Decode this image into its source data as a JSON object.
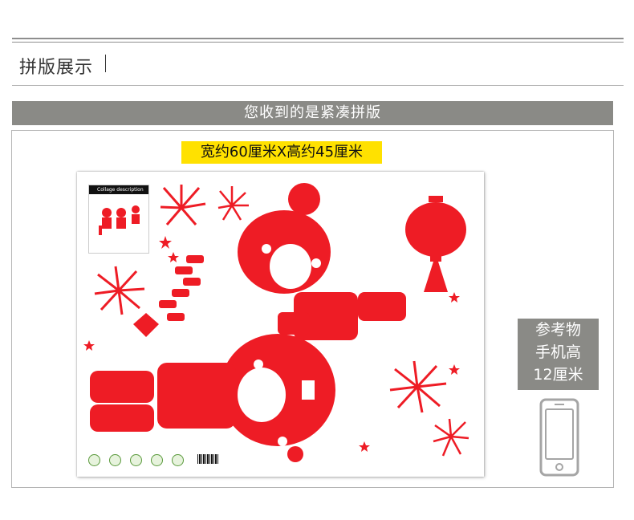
{
  "header": {
    "section_title": "拼版展示"
  },
  "banner": {
    "text": "您收到的是紧凑拼版"
  },
  "size_label": "宽约60厘米X高约45厘米",
  "preview": {
    "thumbnail_title": "Collage description"
  },
  "reference": {
    "lines": [
      "参考物",
      "手机高",
      "12厘米"
    ]
  },
  "colors": {
    "accent_red": "#ee1c25",
    "banner_gray": "#8a8a86",
    "highlight_yellow": "#ffe100"
  }
}
